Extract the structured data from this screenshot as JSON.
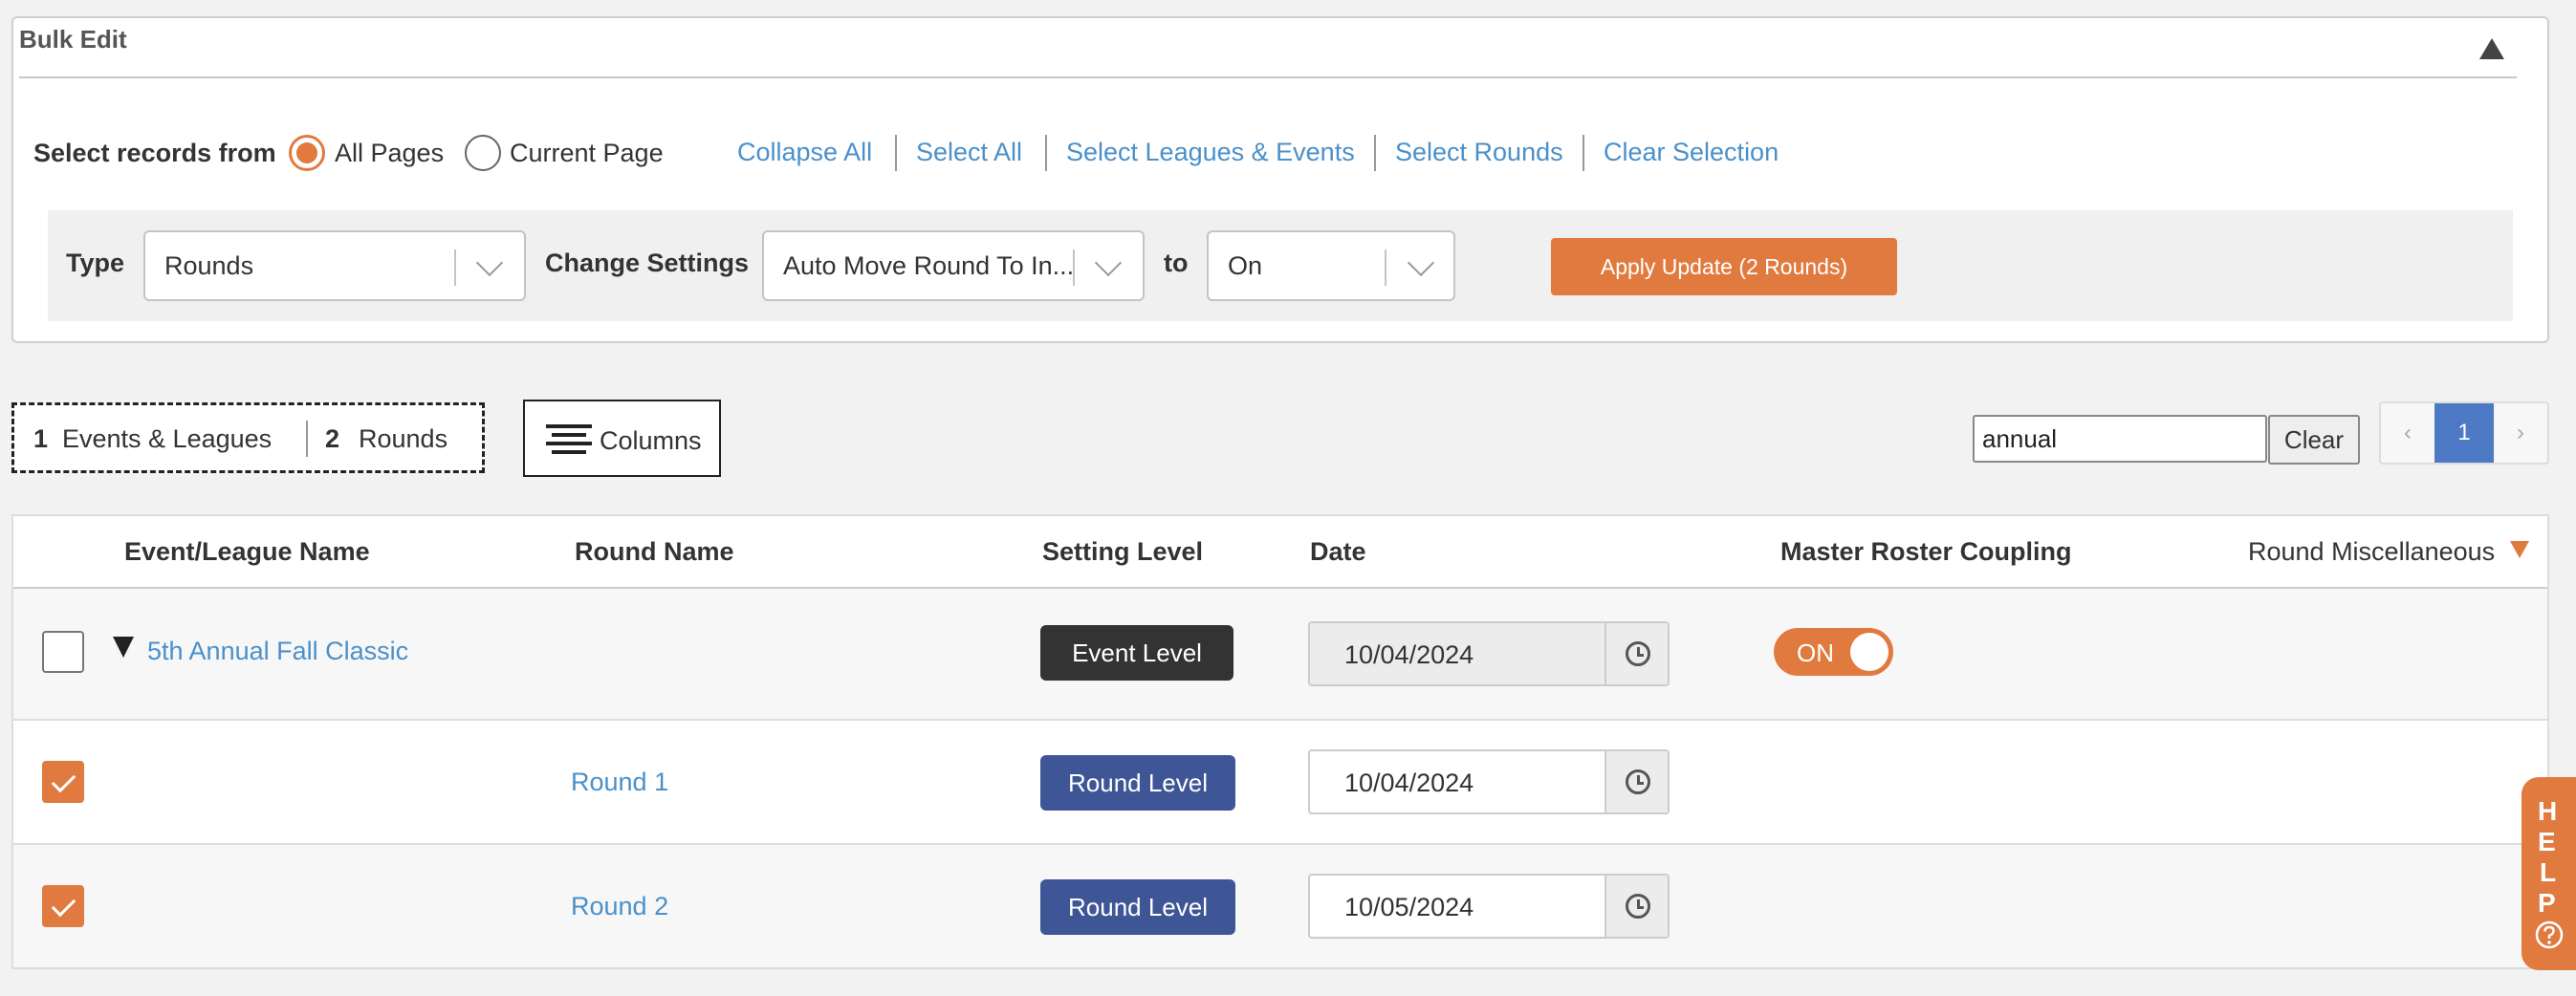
{
  "bulk_edit": {
    "title": "Bulk Edit",
    "select_records_label": "Select records from",
    "radio_all_pages": "All Pages",
    "radio_current_page": "Current Page",
    "links": [
      "Collapse All",
      "Select All",
      "Select Leagues & Events",
      "Select Rounds",
      "Clear Selection"
    ],
    "type_label": "Type",
    "type_value": "Rounds",
    "change_settings_label": "Change Settings",
    "change_settings_value": "Auto Move Round To In...",
    "to_label": "to",
    "to_value": "On",
    "apply_button": "Apply Update (2 Rounds)"
  },
  "summary": {
    "events_count": "1",
    "events_label": "Events & Leagues",
    "rounds_count": "2",
    "rounds_label": "Rounds"
  },
  "columns_button": "Columns",
  "search": {
    "value": "annual",
    "clear_label": "Clear"
  },
  "pagination": {
    "prev": "‹",
    "current": "1",
    "next": "›"
  },
  "table": {
    "headers": {
      "event_league_name": "Event/League Name",
      "round_name": "Round Name",
      "setting_level": "Setting Level",
      "date": "Date",
      "master_roster_coupling": "Master Roster Coupling",
      "round_misc": "Round Miscellaneous"
    },
    "event_row": {
      "name": "5th Annual Fall Classic",
      "level": "Event Level",
      "date": "10/04/2024",
      "coupling": "ON"
    },
    "round_rows": [
      {
        "name": "Round 1",
        "level": "Round Level",
        "date": "10/04/2024"
      },
      {
        "name": "Round 2",
        "level": "Round Level",
        "date": "10/05/2024"
      }
    ]
  },
  "help": [
    "H",
    "E",
    "L",
    "P"
  ],
  "colors": {
    "accent": "#e07a3f",
    "link": "#4a90c9",
    "round_badge": "#3f5696",
    "event_badge": "#333333"
  }
}
